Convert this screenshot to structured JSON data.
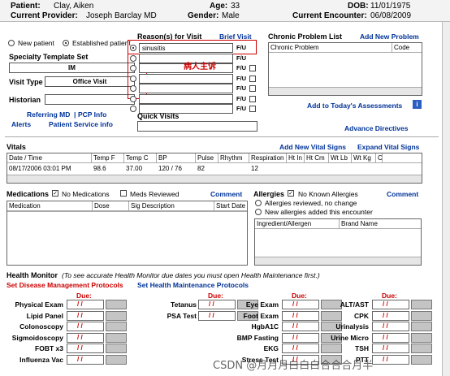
{
  "header": {
    "patient_label": "Patient:",
    "patient": "Clay, Aiken",
    "age_label": "Age:",
    "age": "33",
    "dob_label": "DOB:",
    "dob": "11/01/1975",
    "provider_label": "Current Provider:",
    "provider": "Joseph Barclay MD",
    "gender_label": "Gender:",
    "gender": "Male",
    "encounter_label": "Current Encounter:",
    "encounter": "06/08/2009"
  },
  "patient_type": {
    "new": "New patient",
    "established": "Established patient",
    "selected": "established"
  },
  "specialty": {
    "label": "Specialty Template Set",
    "value": "IM"
  },
  "visit_type": {
    "label": "Visit Type",
    "value": "Office Visit"
  },
  "historian": {
    "label": "Historian"
  },
  "links_left": {
    "referring": "Referring MD",
    "pcp": "PCP Info",
    "separator": "|",
    "alerts": "Alerts",
    "service": "Patient Service info"
  },
  "reasons": {
    "title": "Reason(s) for Visit",
    "brief": "Brief Visit",
    "items": [
      "sinusitis",
      "",
      "",
      "",
      "",
      "",
      ""
    ],
    "fu": "F/U",
    "annotation": "病人主诉"
  },
  "quick_visits": {
    "label": "Quick Visits"
  },
  "chronic": {
    "title": "Chronic Problem List",
    "add": "Add New Problem",
    "columns": [
      "Chronic Problem",
      "Code"
    ],
    "add_assess": "Add to Today's Assessments",
    "info_icon": "i"
  },
  "advance_directives": "Advance Directives",
  "vitals": {
    "title": "Vitals",
    "add": "Add New Vital Signs",
    "expand": "Expand Vital Signs",
    "columns": [
      "Date / Time",
      "Temp F",
      "Temp C",
      "BP",
      "Pulse",
      "Rhythm",
      "Respiration",
      "Ht In",
      "Ht Cm",
      "Wt Lb",
      "Wt Kg",
      "C"
    ],
    "row": [
      "08/17/2006 03:01 PM",
      "98.6",
      "37.00",
      "120 / 76",
      "82",
      "",
      "12",
      "",
      "",
      "",
      "",
      ""
    ]
  },
  "medications": {
    "title": "Medications",
    "no_meds": "No Medications",
    "reviewed": "Meds Reviewed",
    "comment": "Comment",
    "columns": [
      "Medication",
      "Dose",
      "Sig Description",
      "Start Date"
    ]
  },
  "allergies": {
    "title": "Allergies",
    "nka": "No Known Allergies",
    "comment": "Comment",
    "opt1": "Allergies reviewed, no change",
    "opt2": "New allergies added this encounter",
    "columns": [
      "Ingredient/Allergen",
      "Brand Name"
    ]
  },
  "health": {
    "title": "Health Monitor",
    "note": "(To see accurate Health Monitor due dates you must open Health Maintenance first.)",
    "disease": "Set Disease Management Protocols",
    "maint": "Set Health Maintenance Protocols",
    "due": "Due:",
    "blank": "/ /",
    "col1": [
      "Physical Exam",
      "Lipid Panel",
      "Colonoscopy",
      "Sigmoidoscopy",
      "FOBT x3",
      "Influenza Vac"
    ],
    "col2": [
      "Tetanus",
      "PSA Test"
    ],
    "col3": [
      "Eye Exam",
      "Foot Exam",
      "HgbA1C",
      "BMP Fasting",
      "EKG",
      "Stress Test"
    ],
    "col4": [
      "ALT/AST",
      "CPK",
      "Urinalysis",
      "Urine Micro",
      "TSH",
      "PTT"
    ]
  },
  "watermark": "CSDN @月月月白白白合合合月半"
}
